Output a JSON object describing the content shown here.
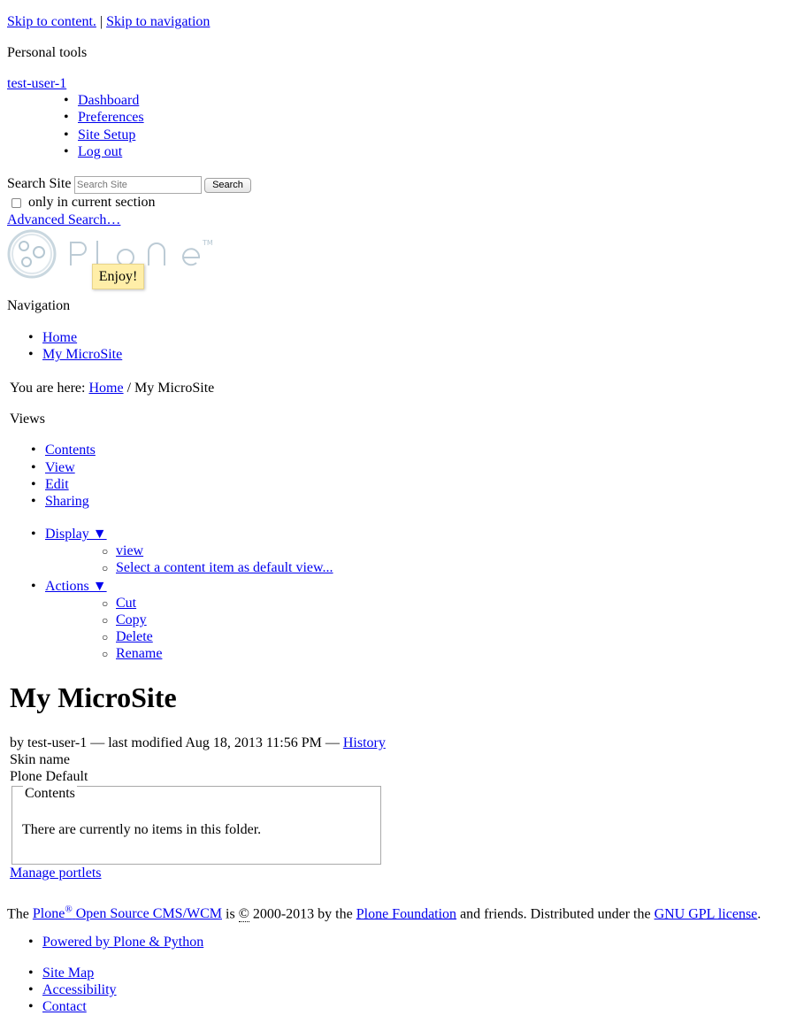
{
  "skip": {
    "content": "Skip to content.",
    "separator": "|",
    "navigation": "Skip to navigation"
  },
  "personal_tools": {
    "heading": "Personal tools",
    "user": "test-user-1",
    "items": [
      "Dashboard",
      "Preferences",
      "Site Setup",
      "Log out"
    ]
  },
  "search": {
    "label": "Search Site",
    "placeholder": "Search Site",
    "button": "Search",
    "checkbox_label": "only in current section",
    "advanced": "Advanced Search…"
  },
  "logo": {
    "text": "Plone",
    "tm": "TM"
  },
  "tooltip": "Enjoy!",
  "navigation": {
    "heading": "Navigation",
    "items": [
      "Home",
      "My MicroSite"
    ]
  },
  "breadcrumbs": {
    "prefix": "You are here:",
    "home": "Home",
    "separator": "/",
    "current": "My MicroSite"
  },
  "views": {
    "heading": "Views",
    "items": [
      "Contents",
      "View",
      "Edit",
      "Sharing"
    ],
    "display": {
      "label": "Display ▼",
      "items": [
        "view",
        "Select a content item as default view..."
      ]
    },
    "actions": {
      "label": "Actions ▼",
      "items": [
        "Cut",
        "Copy",
        "Delete",
        "Rename"
      ]
    }
  },
  "page": {
    "title": "My MicroSite",
    "byline": "by test-user-1 — last modified Aug 18, 2013 11:56 PM —",
    "history": "History",
    "skin_label": "Skin name",
    "skin_value": "Plone Default",
    "contents_legend": "Contents",
    "empty_message": "There are currently no items in this folder."
  },
  "manage_portlets": "Manage portlets",
  "footer": {
    "t1": "The",
    "plone": "Plone",
    "reg": "®",
    "oss": "Open Source CMS/WCM",
    "t2": "is",
    "copy": "©",
    "t3": "2000-2013 by the",
    "foundation": "Plone Foundation",
    "t4": "and friends. Distributed under the",
    "license": "GNU GPL license",
    "t5": ".",
    "powered": "Powered by Plone & Python",
    "links": [
      "Site Map",
      "Accessibility",
      "Contact"
    ]
  }
}
